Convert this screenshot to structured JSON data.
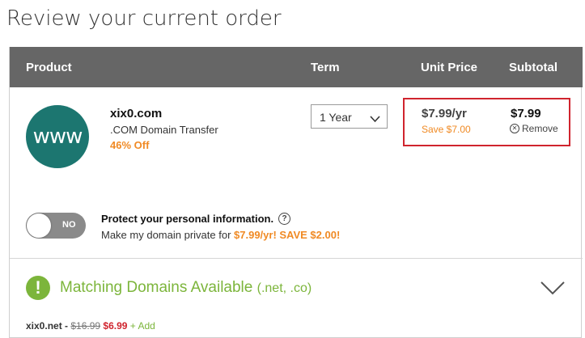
{
  "page": {
    "title": "Review your current order"
  },
  "table": {
    "headers": {
      "product": "Product",
      "term": "Term",
      "unit_price": "Unit Price",
      "subtotal": "Subtotal"
    }
  },
  "item": {
    "logo_text": "www",
    "domain": "xix0.com",
    "description": ".COM Domain Transfer",
    "discount": "46% Off",
    "term": "1 Year",
    "unit_price": "$7.99/yr",
    "savings": "Save $7.00",
    "subtotal": "$7.99",
    "remove_label": "Remove"
  },
  "privacy": {
    "toggle_label": "NO",
    "toggle_state": "off",
    "title": "Protect your personal information.",
    "text_prefix": "Make my domain private for ",
    "offer": "$7.99/yr! SAVE $2.00!"
  },
  "matching": {
    "title": "Matching Domains Available",
    "suffix": "(.net, .co)",
    "expanded": false
  },
  "suggestion": {
    "name": "xix0.net -",
    "old_price": "$16.99",
    "new_price": "$6.99",
    "action": "+ Add"
  },
  "colors": {
    "header_bg": "#666666",
    "accent_orange": "#f08a24",
    "highlight_red": "#d0242e",
    "green": "#7cb53b",
    "logo_teal": "#1c7670"
  }
}
